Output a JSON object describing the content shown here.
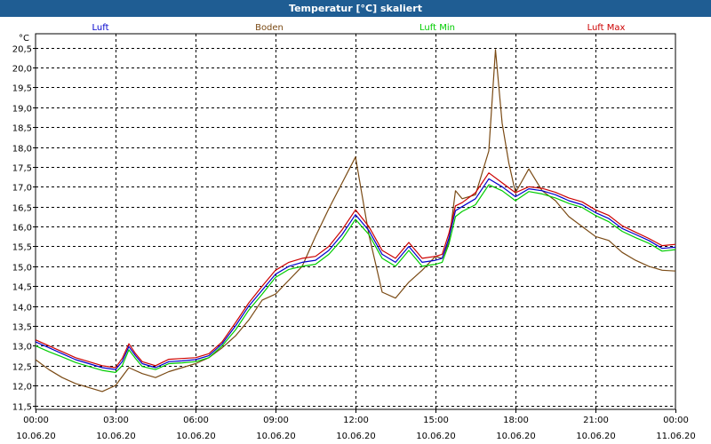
{
  "window": {
    "title": "Temperatur [°C] skaliert",
    "titlebar_color": "#1f5d93"
  },
  "chart_data": {
    "type": "line",
    "title": "Temperatur [°C] skaliert",
    "ylabel": "°C",
    "ylim": [
      11.4,
      20.85
    ],
    "y_ticks": [
      11.5,
      12.0,
      12.5,
      13.0,
      13.5,
      14.0,
      14.5,
      15.0,
      15.5,
      16.0,
      16.5,
      17.0,
      17.5,
      18.0,
      18.5,
      19.0,
      19.5,
      20.0,
      20.5
    ],
    "y_tick_labels": [
      "11,5",
      "12,0",
      "12,5",
      "13,0",
      "13,5",
      "14,0",
      "14,5",
      "15,0",
      "15,5",
      "16,0",
      "16,5",
      "17,0",
      "17,5",
      "18,0",
      "18,5",
      "19,0",
      "19,5",
      "20,0",
      "20,5"
    ],
    "xlim": [
      0,
      24
    ],
    "x_ticks": [
      {
        "h": 0,
        "time": "00:00",
        "date": "10.06.20"
      },
      {
        "h": 3,
        "time": "03:00",
        "date": "10.06.20"
      },
      {
        "h": 6,
        "time": "06:00",
        "date": "10.06.20"
      },
      {
        "h": 9,
        "time": "09:00",
        "date": "10.06.20"
      },
      {
        "h": 12,
        "time": "12:00",
        "date": "10.06.20"
      },
      {
        "h": 15,
        "time": "15:00",
        "date": "10.06.20"
      },
      {
        "h": 18,
        "time": "18:00",
        "date": "10.06.20"
      },
      {
        "h": 21,
        "time": "21:00",
        "date": "10.06.20"
      },
      {
        "h": 24,
        "time": "00:00",
        "date": "11.06.20"
      }
    ],
    "grid": true,
    "legend_position": "top",
    "series": [
      {
        "name": "Luft",
        "color": "#0000cc",
        "x": [
          0,
          0.5,
          1,
          1.5,
          2,
          2.5,
          3,
          3.25,
          3.5,
          3.75,
          4,
          4.5,
          5,
          5.5,
          6,
          6.5,
          7,
          7.5,
          8,
          8.5,
          9,
          9.5,
          10,
          10.5,
          11,
          11.5,
          12,
          12.5,
          13,
          13.5,
          14,
          14.5,
          15,
          15.25,
          15.5,
          15.75,
          16,
          16.5,
          17,
          17.5,
          18,
          18.5,
          19,
          19.5,
          20,
          20.5,
          21,
          21.5,
          22,
          22.5,
          23,
          23.5,
          24
        ],
        "y": [
          13.1,
          12.95,
          12.8,
          12.65,
          12.55,
          12.45,
          12.4,
          12.6,
          12.98,
          12.75,
          12.55,
          12.45,
          12.6,
          12.62,
          12.65,
          12.75,
          13.05,
          13.5,
          14.0,
          14.4,
          14.8,
          15.0,
          15.1,
          15.15,
          15.4,
          15.8,
          16.3,
          15.9,
          15.3,
          15.1,
          15.5,
          15.1,
          15.15,
          15.2,
          15.7,
          16.4,
          16.5,
          16.7,
          17.2,
          17.0,
          16.75,
          16.95,
          16.9,
          16.8,
          16.65,
          16.55,
          16.35,
          16.2,
          15.95,
          15.8,
          15.65,
          15.45,
          15.48
        ]
      },
      {
        "name": "Boden",
        "color": "#7a4a14",
        "x": [
          0,
          0.5,
          1,
          1.5,
          2,
          2.5,
          3,
          3.5,
          4,
          4.5,
          5,
          5.5,
          6,
          6.5,
          7,
          7.5,
          8,
          8.5,
          9,
          9.5,
          10,
          10.5,
          11,
          11.5,
          12,
          12.5,
          13,
          13.5,
          14,
          14.5,
          15,
          15.25,
          15.5,
          15.75,
          16,
          16.5,
          17,
          17.25,
          17.5,
          17.75,
          18,
          18.5,
          19,
          19.5,
          20,
          20.5,
          21,
          21.5,
          22,
          22.5,
          23,
          23.5,
          24
        ],
        "y": [
          12.65,
          12.4,
          12.2,
          12.05,
          11.95,
          11.85,
          12.0,
          12.45,
          12.3,
          12.2,
          12.35,
          12.45,
          12.55,
          12.7,
          12.95,
          13.25,
          13.65,
          14.15,
          14.3,
          14.65,
          15.0,
          15.75,
          16.45,
          17.1,
          17.75,
          15.8,
          14.35,
          14.2,
          14.6,
          14.9,
          15.25,
          15.2,
          15.6,
          16.9,
          16.7,
          16.8,
          17.9,
          20.45,
          18.6,
          17.6,
          16.85,
          17.45,
          16.9,
          16.65,
          16.25,
          16.0,
          15.75,
          15.65,
          15.35,
          15.15,
          15.0,
          14.9,
          14.88
        ]
      },
      {
        "name": "Luft Min",
        "color": "#00cc00",
        "x": [
          0,
          0.5,
          1,
          1.5,
          2,
          2.5,
          3,
          3.25,
          3.5,
          3.75,
          4,
          4.5,
          5,
          5.5,
          6,
          6.5,
          7,
          7.5,
          8,
          8.5,
          9,
          9.5,
          10,
          10.5,
          11,
          11.5,
          12,
          12.5,
          13,
          13.5,
          14,
          14.5,
          15,
          15.25,
          15.5,
          15.75,
          16,
          16.5,
          17,
          17.5,
          18,
          18.5,
          19,
          19.5,
          20,
          20.5,
          21,
          21.5,
          22,
          22.5,
          23,
          23.5,
          24
        ],
        "y": [
          13.0,
          12.85,
          12.72,
          12.58,
          12.48,
          12.38,
          12.33,
          12.5,
          12.9,
          12.68,
          12.48,
          12.4,
          12.55,
          12.57,
          12.6,
          12.7,
          13.0,
          13.4,
          13.9,
          14.3,
          14.72,
          14.92,
          15.0,
          15.05,
          15.3,
          15.68,
          16.18,
          15.8,
          15.2,
          15.0,
          15.4,
          15.0,
          15.05,
          15.1,
          15.55,
          16.25,
          16.38,
          16.55,
          17.05,
          16.9,
          16.65,
          16.88,
          16.82,
          16.72,
          16.58,
          16.48,
          16.28,
          16.12,
          15.88,
          15.72,
          15.58,
          15.38,
          15.42
        ]
      },
      {
        "name": "Luft Max",
        "color": "#cc0000",
        "x": [
          0,
          0.5,
          1,
          1.5,
          2,
          2.5,
          3,
          3.25,
          3.5,
          3.75,
          4,
          4.5,
          5,
          5.5,
          6,
          6.5,
          7,
          7.5,
          8,
          8.5,
          9,
          9.5,
          10,
          10.5,
          11,
          11.5,
          12,
          12.5,
          13,
          13.5,
          14,
          14.5,
          15,
          15.25,
          15.5,
          15.75,
          16,
          16.5,
          17,
          17.5,
          18,
          18.5,
          19,
          19.5,
          20,
          20.5,
          21,
          21.5,
          22,
          22.5,
          23,
          23.5,
          24
        ],
        "y": [
          13.15,
          13.0,
          12.85,
          12.7,
          12.6,
          12.5,
          12.45,
          12.68,
          13.05,
          12.8,
          12.6,
          12.5,
          12.66,
          12.68,
          12.7,
          12.8,
          13.1,
          13.58,
          14.08,
          14.5,
          14.9,
          15.1,
          15.2,
          15.25,
          15.5,
          15.92,
          16.42,
          16.0,
          15.4,
          15.2,
          15.6,
          15.2,
          15.25,
          15.3,
          15.82,
          16.52,
          16.6,
          16.85,
          17.35,
          17.1,
          16.85,
          17.0,
          16.96,
          16.86,
          16.72,
          16.62,
          16.42,
          16.28,
          16.02,
          15.86,
          15.7,
          15.52,
          15.55
        ]
      }
    ]
  }
}
